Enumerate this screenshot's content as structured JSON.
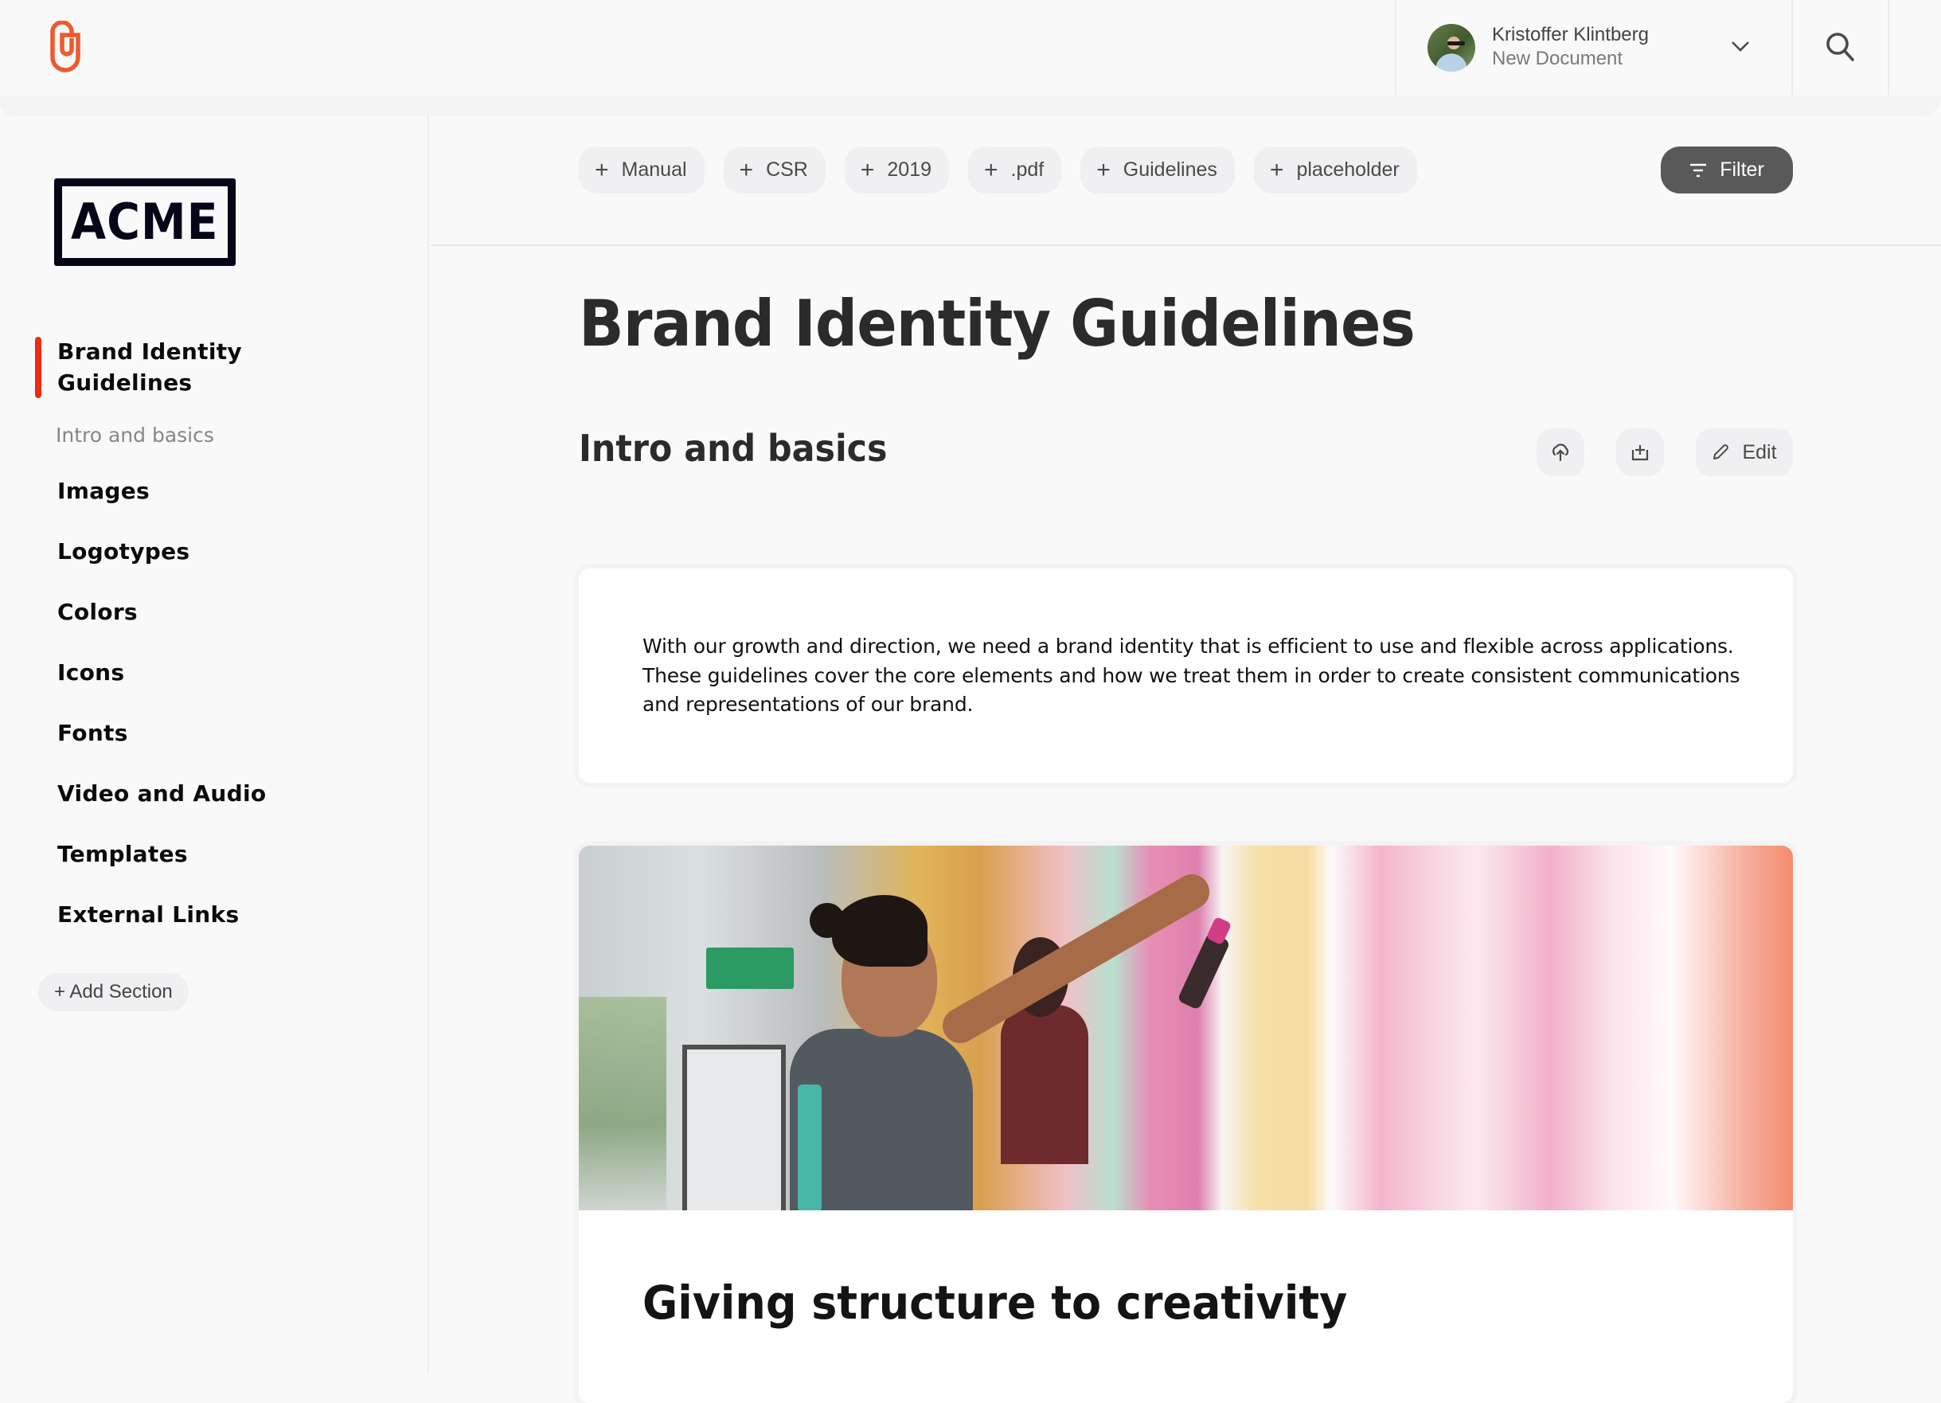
{
  "header": {
    "app_logo": "paperclip-logo-icon",
    "user": {
      "name": "Kristoffer Klintberg",
      "subtitle": "New Document"
    },
    "icons": {
      "dropdown": "chevron-down-icon",
      "search": "search-icon"
    }
  },
  "sidebar": {
    "brand_logo_text": "ACME",
    "active_item": "Brand Identity Guidelines",
    "active_subitem": "Intro and basics",
    "items": [
      {
        "label": "Images"
      },
      {
        "label": "Logotypes"
      },
      {
        "label": "Colors"
      },
      {
        "label": "Icons"
      },
      {
        "label": "Fonts"
      },
      {
        "label": "Video and Audio"
      },
      {
        "label": "Templates"
      },
      {
        "label": "External Links"
      }
    ],
    "add_section_label": "+ Add Section",
    "accent_color": "#ee2a12"
  },
  "toolbar": {
    "tags": [
      {
        "label": "Manual"
      },
      {
        "label": "CSR"
      },
      {
        "label": "2019"
      },
      {
        "label": ".pdf"
      },
      {
        "label": "Guidelines"
      },
      {
        "label": "placeholder"
      }
    ],
    "tag_plus": "+",
    "filter_label": "Filter"
  },
  "content": {
    "page_title": "Brand Identity Guidelines",
    "section_title": "Intro and basics",
    "actions": {
      "upload_icon": "cloud-upload-icon",
      "add_icon": "add-to-tray-icon",
      "edit_label": "Edit"
    },
    "intro_paragraph": "With our growth and direction, we need a brand identity that is efficient to use and flexible across applications. These guidelines cover the core elements and how we treat them in order to create consistent communications and representations of our brand.",
    "image_alt": "Artist spray painting a colorful pink mural",
    "card_heading": "Giving structure to creativity"
  },
  "colors": {
    "logo_orange": "#ee5a2f",
    "filter_button_bg": "#595959",
    "chip_bg": "#f0f0f2",
    "background": "#f9f9f9"
  }
}
